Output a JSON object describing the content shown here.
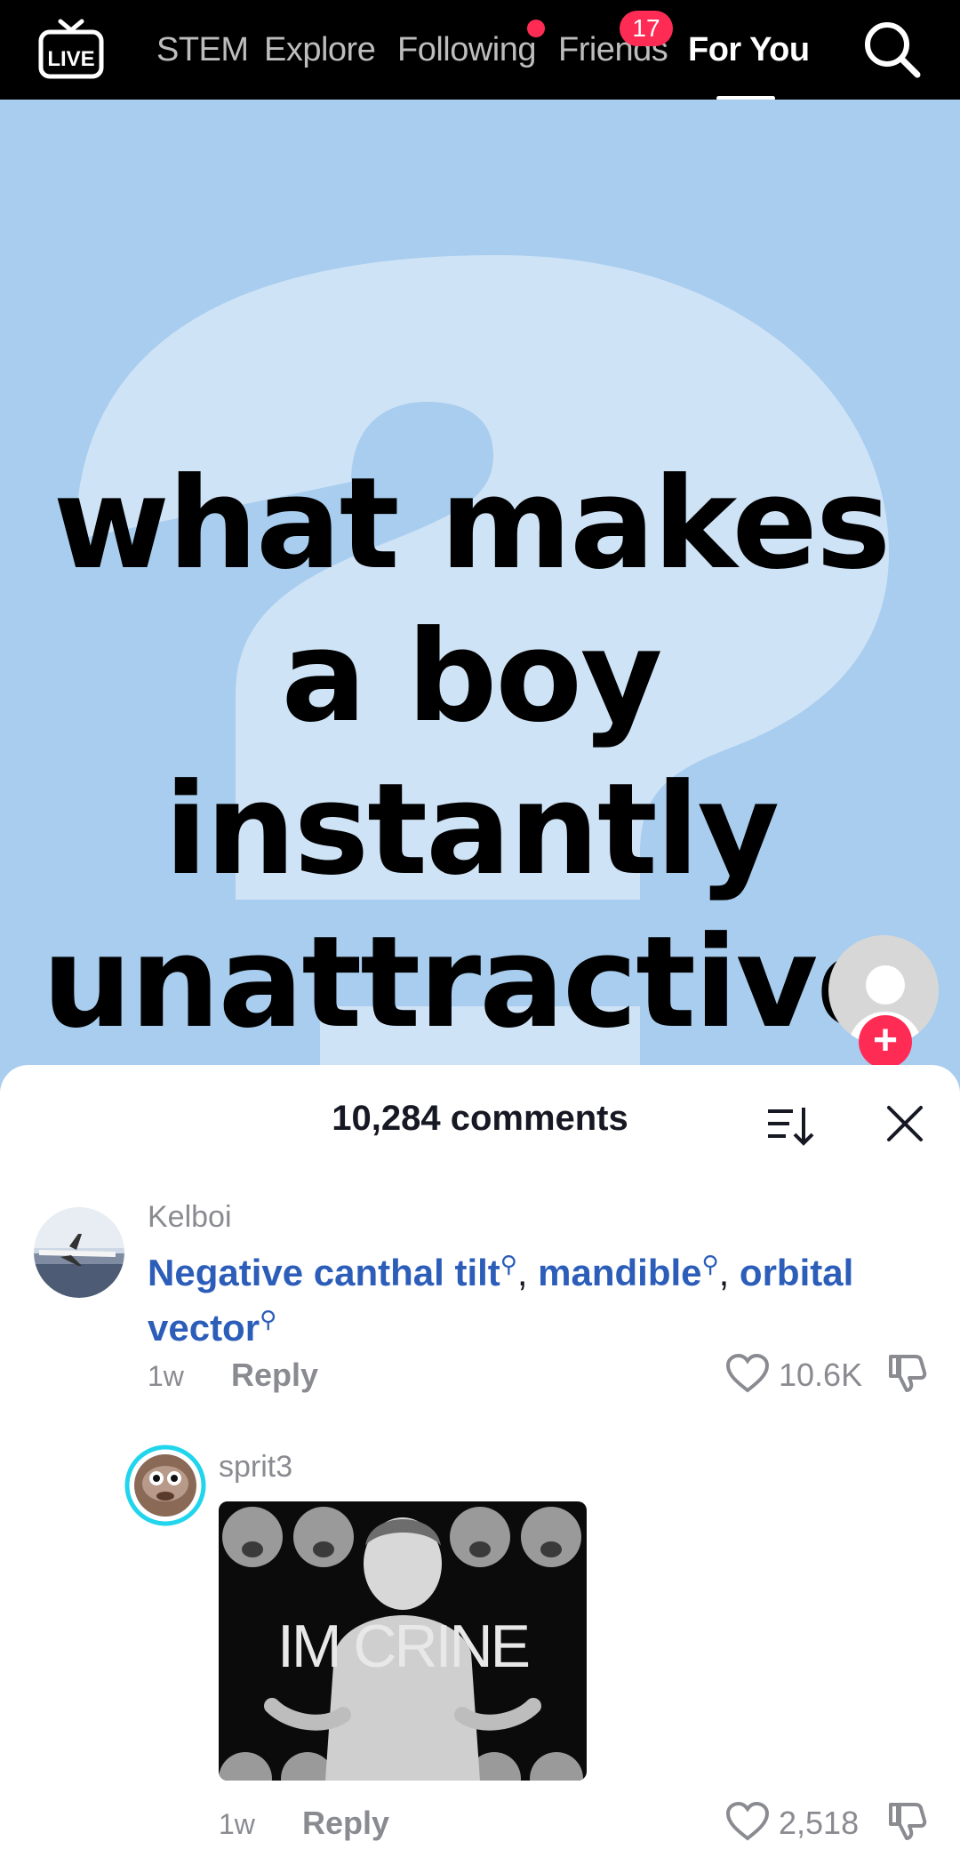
{
  "nav": {
    "live_label": "LIVE",
    "tabs": [
      {
        "label": "STEM"
      },
      {
        "label": "Explore"
      },
      {
        "label": "Following"
      },
      {
        "label": "Friends",
        "badge": "17"
      },
      {
        "label": "For You"
      }
    ]
  },
  "video": {
    "overlay_text": "what makes a boy instantly unattractive"
  },
  "comments": {
    "title": "10,284 comments",
    "items": [
      {
        "username": "Kelboi",
        "keywords": [
          "Negative canthal tilt",
          "mandible",
          "orbital vector"
        ],
        "time": "1w",
        "reply_label": "Reply",
        "likes": "10.6K"
      },
      {
        "username": "sprit3",
        "gif_caption": "IM CRINE",
        "time": "1w",
        "reply_label": "Reply",
        "likes": "2,518"
      }
    ]
  },
  "colors": {
    "accent": "#fe2c55",
    "keyword": "#2b5db9",
    "video_bg": "#a8cdee",
    "story_ring": "#20d5ec"
  }
}
